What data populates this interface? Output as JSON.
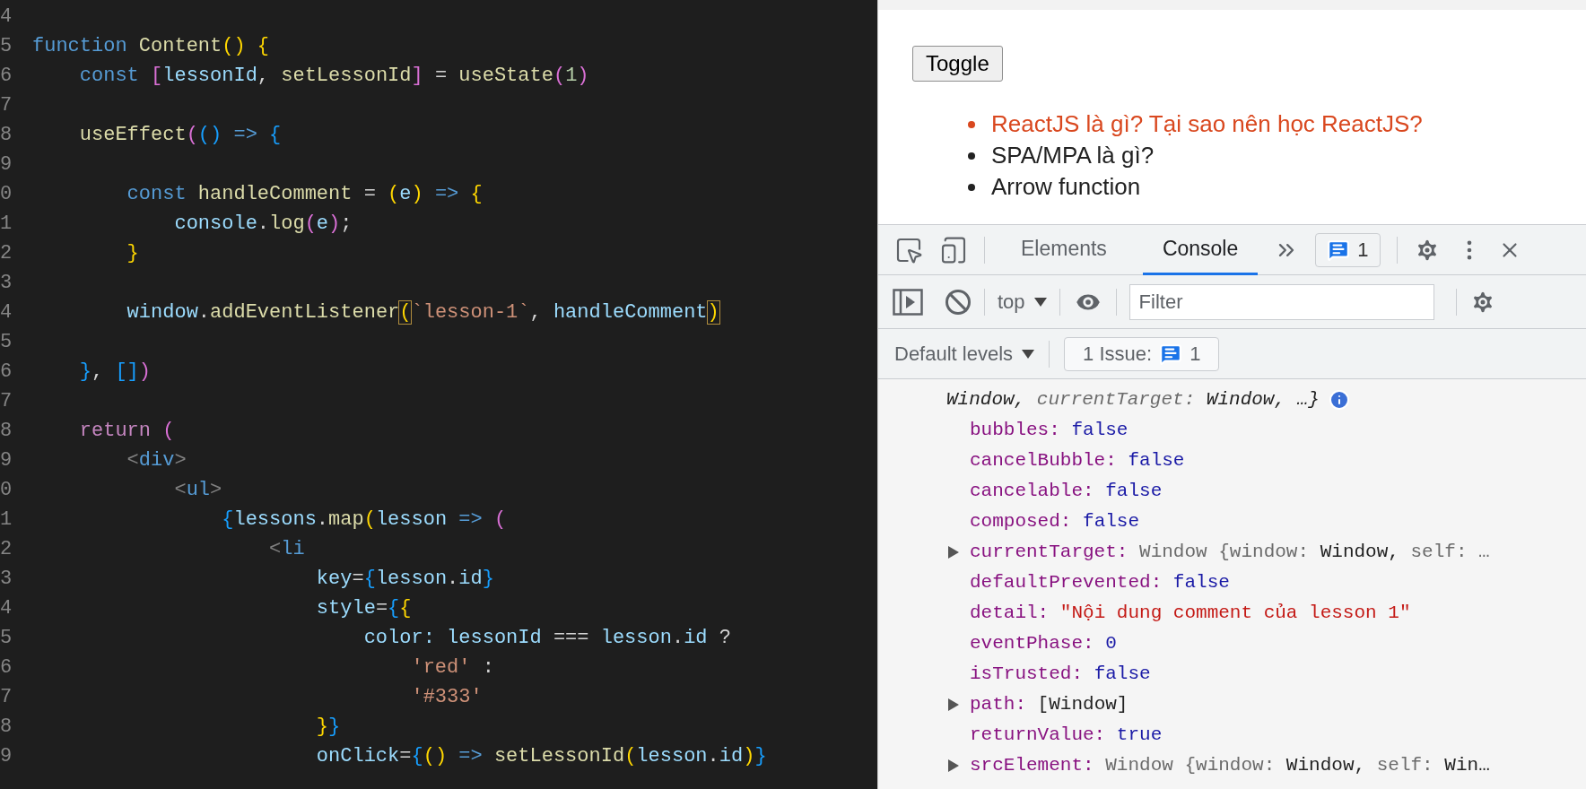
{
  "editor": {
    "lines": [
      {
        "n": "4"
      },
      {
        "n": "5",
        "tokens": [
          {
            "kind": "kw",
            "text": "function"
          },
          {
            "kind": "fn",
            "text": " Content"
          },
          {
            "kind": "br1",
            "text": "()"
          },
          {
            "kind": "br1",
            "text": " {"
          }
        ]
      },
      {
        "n": "6",
        "tokens": [
          {
            "kind": "kw",
            "text": "    const"
          },
          {
            "kind": "br2",
            "text": " ["
          },
          {
            "kind": "var",
            "text": "lessonId"
          },
          {
            "kind": "plain",
            "text": ", "
          },
          {
            "kind": "fn",
            "text": "setLessonId"
          },
          {
            "kind": "br2",
            "text": "]"
          },
          {
            "kind": "plain",
            "text": " = "
          },
          {
            "kind": "fn",
            "text": "useState"
          },
          {
            "kind": "br2",
            "text": "("
          },
          {
            "kind": "num",
            "text": "1"
          },
          {
            "kind": "br2",
            "text": ")"
          }
        ]
      },
      {
        "n": "7"
      },
      {
        "n": "8",
        "tokens": [
          {
            "kind": "fn",
            "text": "    useEffect"
          },
          {
            "kind": "br2",
            "text": "("
          },
          {
            "kind": "br3",
            "text": "()"
          },
          {
            "kind": "kw",
            "text": " =>"
          },
          {
            "kind": "br3",
            "text": " {"
          }
        ]
      },
      {
        "n": "9"
      },
      {
        "n": "0",
        "tokens": [
          {
            "kind": "kw",
            "text": "        const"
          },
          {
            "kind": "fn",
            "text": " handleComment"
          },
          {
            "kind": "plain",
            "text": " = "
          },
          {
            "kind": "br1",
            "text": "("
          },
          {
            "kind": "var",
            "text": "e"
          },
          {
            "kind": "br1",
            "text": ")"
          },
          {
            "kind": "kw",
            "text": " =>"
          },
          {
            "kind": "br1",
            "text": " {"
          }
        ]
      },
      {
        "n": "1",
        "tokens": [
          {
            "kind": "var",
            "text": "            console"
          },
          {
            "kind": "plain",
            "text": "."
          },
          {
            "kind": "fn",
            "text": "log"
          },
          {
            "kind": "br2",
            "text": "("
          },
          {
            "kind": "var",
            "text": "e"
          },
          {
            "kind": "br2",
            "text": ")"
          },
          {
            "kind": "plain",
            "text": ";"
          }
        ]
      },
      {
        "n": "2",
        "tokens": [
          {
            "kind": "br1",
            "text": "        }"
          }
        ]
      },
      {
        "n": "3"
      },
      {
        "n": "4",
        "tokens": [
          {
            "kind": "var",
            "text": "        window"
          },
          {
            "kind": "plain",
            "text": "."
          },
          {
            "kind": "fn",
            "text": "addEventListener"
          },
          {
            "kind": "matched",
            "text": "("
          },
          {
            "kind": "str",
            "text": "`lesson-1`"
          },
          {
            "kind": "plain",
            "text": ", "
          },
          {
            "kind": "var",
            "text": "handleComment"
          },
          {
            "kind": "matched",
            "text": ")"
          }
        ]
      },
      {
        "n": "5"
      },
      {
        "n": "6",
        "tokens": [
          {
            "kind": "br3",
            "text": "    }"
          },
          {
            "kind": "plain",
            "text": ", "
          },
          {
            "kind": "br3",
            "text": "[]"
          },
          {
            "kind": "br2",
            "text": ")"
          }
        ]
      },
      {
        "n": "7"
      },
      {
        "n": "8",
        "tokens": [
          {
            "kind": "ctrl",
            "text": "    return"
          },
          {
            "kind": "br2",
            "text": " ("
          }
        ]
      },
      {
        "n": "9",
        "tokens": [
          {
            "kind": "tag",
            "text": "        <"
          },
          {
            "kind": "tagname",
            "text": "div"
          },
          {
            "kind": "tag",
            "text": ">"
          }
        ]
      },
      {
        "n": "0",
        "tokens": [
          {
            "kind": "tag",
            "text": "            <"
          },
          {
            "kind": "tagname",
            "text": "ul"
          },
          {
            "kind": "tag",
            "text": ">"
          }
        ]
      },
      {
        "n": "1",
        "tokens": [
          {
            "kind": "br3",
            "text": "                {"
          },
          {
            "kind": "var",
            "text": "lessons"
          },
          {
            "kind": "plain",
            "text": "."
          },
          {
            "kind": "fn",
            "text": "map"
          },
          {
            "kind": "br1",
            "text": "("
          },
          {
            "kind": "var",
            "text": "lesson"
          },
          {
            "kind": "kw",
            "text": " =>"
          },
          {
            "kind": "br2",
            "text": " ("
          }
        ]
      },
      {
        "n": "2",
        "tokens": [
          {
            "kind": "tag",
            "text": "                    <"
          },
          {
            "kind": "tagname",
            "text": "li"
          }
        ]
      },
      {
        "n": "3",
        "tokens": [
          {
            "kind": "var",
            "text": "                        key"
          },
          {
            "kind": "plain",
            "text": "="
          },
          {
            "kind": "br3",
            "text": "{"
          },
          {
            "kind": "var",
            "text": "lesson"
          },
          {
            "kind": "plain",
            "text": "."
          },
          {
            "kind": "var",
            "text": "id"
          },
          {
            "kind": "br3",
            "text": "}"
          }
        ]
      },
      {
        "n": "4",
        "tokens": [
          {
            "kind": "var",
            "text": "                        style"
          },
          {
            "kind": "plain",
            "text": "="
          },
          {
            "kind": "br3",
            "text": "{"
          },
          {
            "kind": "br1",
            "text": "{"
          }
        ]
      },
      {
        "n": "5",
        "tokens": [
          {
            "kind": "var",
            "text": "                            color:"
          },
          {
            "kind": "var",
            "text": " lessonId"
          },
          {
            "kind": "plain",
            "text": " === "
          },
          {
            "kind": "var",
            "text": "lesson"
          },
          {
            "kind": "plain",
            "text": "."
          },
          {
            "kind": "var",
            "text": "id"
          },
          {
            "kind": "plain",
            "text": " ?"
          }
        ]
      },
      {
        "n": "6",
        "tokens": [
          {
            "kind": "str",
            "text": "                                'red'"
          },
          {
            "kind": "plain",
            "text": " :"
          }
        ]
      },
      {
        "n": "7",
        "tokens": [
          {
            "kind": "str",
            "text": "                                '#333'"
          }
        ]
      },
      {
        "n": "8",
        "tokens": [
          {
            "kind": "br1",
            "text": "                        }"
          },
          {
            "kind": "br3",
            "text": "}"
          }
        ]
      },
      {
        "n": "9",
        "tokens": [
          {
            "kind": "var",
            "text": "                        onClick"
          },
          {
            "kind": "plain",
            "text": "="
          },
          {
            "kind": "br3",
            "text": "{"
          },
          {
            "kind": "br1",
            "text": "()"
          },
          {
            "kind": "kw",
            "text": " =>"
          },
          {
            "kind": "fn",
            "text": " setLessonId"
          },
          {
            "kind": "br1",
            "text": "("
          },
          {
            "kind": "var",
            "text": "lesson"
          },
          {
            "kind": "plain",
            "text": "."
          },
          {
            "kind": "var",
            "text": "id"
          },
          {
            "kind": "br1",
            "text": ")"
          },
          {
            "kind": "br3",
            "text": "}"
          }
        ]
      }
    ]
  },
  "page": {
    "button": "Toggle",
    "lessons": [
      {
        "title": "ReactJS là gì? Tại sao nên học ReactJS?",
        "selected": true
      },
      {
        "title": "SPA/MPA là gì?",
        "selected": false
      },
      {
        "title": "Arrow function",
        "selected": false
      }
    ]
  },
  "devtools": {
    "tabs": [
      {
        "label": "Elements",
        "selected": false
      },
      {
        "label": "Console",
        "selected": true
      }
    ],
    "message_count": "1",
    "context": "top",
    "filter": {
      "placeholder": "Filter"
    },
    "levels": "Default levels",
    "issues": {
      "label": "1 Issue:",
      "count": "1"
    },
    "console": {
      "summary": [
        {
          "kind": "dark",
          "text": "Window,"
        },
        {
          "kind": "gray",
          "text": " currentTarget:"
        },
        {
          "kind": "dark",
          "text": " Window, …}"
        }
      ],
      "properties": [
        {
          "expandable": false,
          "parts": [
            {
              "kind": "key",
              "text": "bubbles:"
            },
            {
              "kind": "bool",
              "text": " false"
            }
          ]
        },
        {
          "expandable": false,
          "parts": [
            {
              "kind": "key",
              "text": "cancelBubble:"
            },
            {
              "kind": "bool",
              "text": " false"
            }
          ]
        },
        {
          "expandable": false,
          "parts": [
            {
              "kind": "key",
              "text": "cancelable:"
            },
            {
              "kind": "bool",
              "text": " false"
            }
          ]
        },
        {
          "expandable": false,
          "parts": [
            {
              "kind": "key",
              "text": "composed:"
            },
            {
              "kind": "bool",
              "text": " false"
            }
          ]
        },
        {
          "expandable": true,
          "parts": [
            {
              "kind": "key",
              "text": "currentTarget:"
            },
            {
              "kind": "gray",
              "text": " Window {window:"
            },
            {
              "kind": "dark",
              "text": " Window,"
            },
            {
              "kind": "gray",
              "text": " self: …"
            }
          ]
        },
        {
          "expandable": false,
          "parts": [
            {
              "kind": "key",
              "text": "defaultPrevented:"
            },
            {
              "kind": "bool",
              "text": " false"
            }
          ]
        },
        {
          "expandable": false,
          "parts": [
            {
              "kind": "key",
              "text": "detail:"
            },
            {
              "kind": "str",
              "text": " \"Nội dung comment của lesson 1\""
            }
          ]
        },
        {
          "expandable": false,
          "parts": [
            {
              "kind": "key",
              "text": "eventPhase:"
            },
            {
              "kind": "bool",
              "text": " 0"
            }
          ]
        },
        {
          "expandable": false,
          "parts": [
            {
              "kind": "key",
              "text": "isTrusted:"
            },
            {
              "kind": "bool",
              "text": " false"
            }
          ]
        },
        {
          "expandable": true,
          "parts": [
            {
              "kind": "key",
              "text": "path:"
            },
            {
              "kind": "dark",
              "text": " [Window]"
            }
          ]
        },
        {
          "expandable": false,
          "parts": [
            {
              "kind": "key",
              "text": "returnValue:"
            },
            {
              "kind": "bool",
              "text": " true"
            }
          ]
        },
        {
          "expandable": true,
          "parts": [
            {
              "kind": "key",
              "text": "srcElement:"
            },
            {
              "kind": "gray",
              "text": " Window {window:"
            },
            {
              "kind": "dark",
              "text": " Window,"
            },
            {
              "kind": "gray",
              "text": " self:"
            },
            {
              "kind": "dark",
              "text": " Win…"
            }
          ]
        }
      ]
    }
  }
}
